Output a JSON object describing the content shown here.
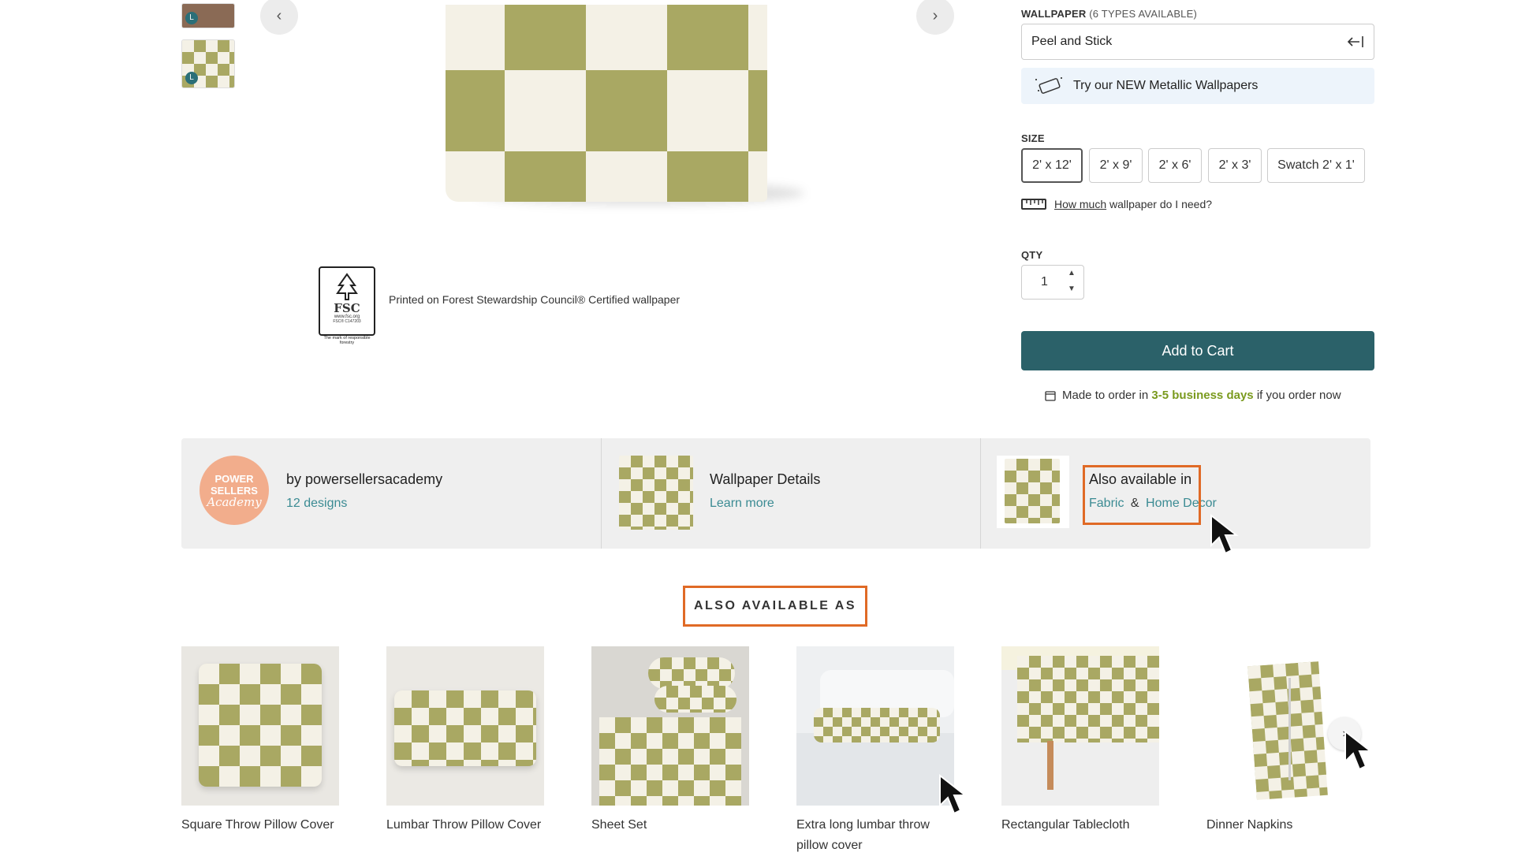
{
  "thumbnails": [
    {
      "badge": "L"
    },
    {
      "badge": "L"
    }
  ],
  "gallery": {
    "prev_icon": "‹",
    "next_icon": "›"
  },
  "fsc": {
    "logo_text": "FSC",
    "site": "www.fsc.org",
    "code": "FSC® C147203",
    "tagline": "The mark of responsible forestry",
    "caption": "Printed on Forest Stewardship Council® Certified wallpaper"
  },
  "wallpaper": {
    "label": "WALLPAPER",
    "types_note": "(6 TYPES AVAILABLE)",
    "selected": "Peel and Stick",
    "promo": "Try our NEW Metallic Wallpapers"
  },
  "size": {
    "label": "SIZE",
    "options": [
      "2' x 12'",
      "2' x 9'",
      "2' x 6'",
      "2' x 3'",
      "Swatch 2' x 1'"
    ],
    "help_link": "How much",
    "help_rest": "wallpaper do I need?"
  },
  "qty": {
    "label": "QTY",
    "value": "1"
  },
  "cart": {
    "add_label": "Add to Cart",
    "order_prefix": "Made to order in",
    "order_days": "3-5 business days",
    "order_suffix": "if you order now"
  },
  "band": {
    "avatar_line1": "POWER",
    "avatar_line2": "SELLERS",
    "avatar_line3": "Academy",
    "designer": "by powersellersacademy",
    "designs": "12 designs",
    "details_title": "Wallpaper Details",
    "details_link": "Learn more",
    "also_title": "Also available in",
    "fabric": "Fabric",
    "amp": "&",
    "home_decor": "Home Decor"
  },
  "also_as": {
    "heading": "ALSO AVAILABLE AS",
    "products": [
      {
        "name": "Square Throw Pillow Cover"
      },
      {
        "name": "Lumbar Throw Pillow Cover"
      },
      {
        "name": "Sheet Set"
      },
      {
        "name": "Extra long lumbar throw pillow cover"
      },
      {
        "name": "Rectangular Tablecloth"
      },
      {
        "name": "Dinner Napkins"
      }
    ],
    "next_icon": "›"
  },
  "colors": {
    "accent": "#2b6169",
    "link": "#3b8b93",
    "highlight": "#e06a26",
    "pattern": "#a9a863"
  }
}
